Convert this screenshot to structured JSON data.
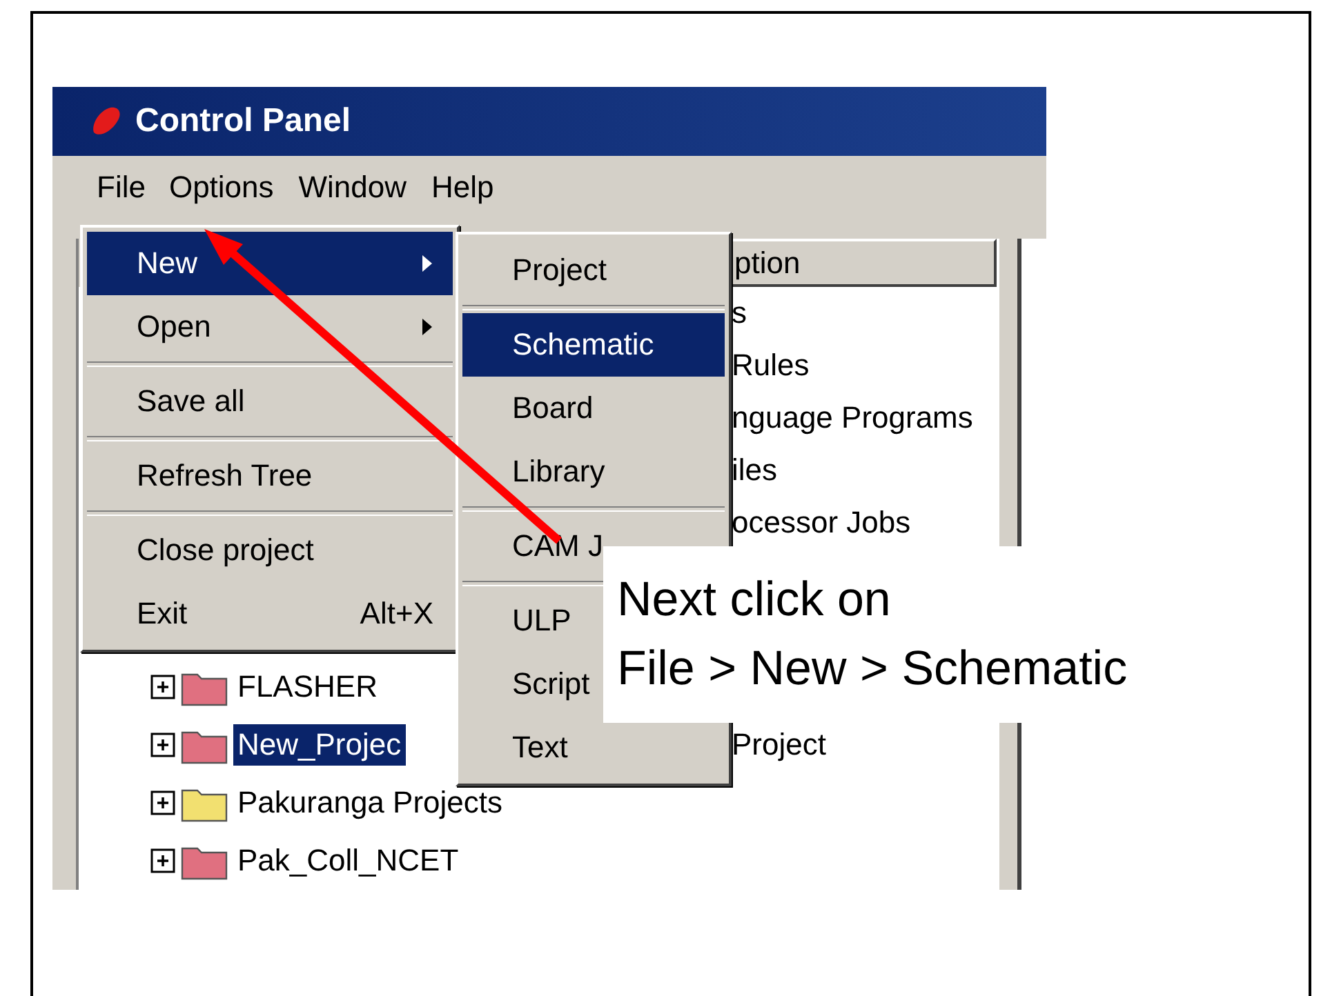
{
  "window": {
    "title": "Control Panel"
  },
  "menu_bar": [
    {
      "label": "File",
      "selected": true
    },
    {
      "label": "Options",
      "selected": false
    },
    {
      "label": "Window",
      "selected": false
    },
    {
      "label": "Help",
      "selected": false
    }
  ],
  "description_header": "ption",
  "description_cells": [
    "s",
    "Rules",
    "nguage Programs",
    "iles",
    "ocessor Jobs"
  ],
  "tree": [
    {
      "name": "FLASHER",
      "color": "#e07080",
      "selected": false
    },
    {
      "name": "New_Projec",
      "color": "#e07080",
      "selected": true,
      "description": "Project"
    },
    {
      "name": "Pakuranga Projects",
      "color": "#f2e070",
      "selected": false
    },
    {
      "name": "Pak_Coll_NCET",
      "color": "#e07080",
      "selected": false
    }
  ],
  "file_menu": [
    {
      "kind": "item",
      "label": "New",
      "selected": true,
      "submenu": true
    },
    {
      "kind": "item",
      "label": "Open",
      "selected": false,
      "submenu": true
    },
    {
      "kind": "separator"
    },
    {
      "kind": "item",
      "label": "Save all",
      "selected": false,
      "submenu": false
    },
    {
      "kind": "separator"
    },
    {
      "kind": "item",
      "label": "Refresh Tree",
      "selected": false,
      "submenu": false
    },
    {
      "kind": "separator"
    },
    {
      "kind": "item",
      "label": "Close project",
      "selected": false,
      "submenu": false
    },
    {
      "kind": "item",
      "label": "Exit",
      "shortcut": "Alt+X",
      "selected": false,
      "submenu": false
    }
  ],
  "new_submenu": [
    {
      "kind": "item",
      "label": "Project",
      "selected": false
    },
    {
      "kind": "separator"
    },
    {
      "kind": "item",
      "label": "Schematic",
      "selected": true
    },
    {
      "kind": "item",
      "label": "Board",
      "selected": false
    },
    {
      "kind": "item",
      "label": "Library",
      "selected": false
    },
    {
      "kind": "separator"
    },
    {
      "kind": "item",
      "label": "CAM J",
      "selected": false
    },
    {
      "kind": "separator"
    },
    {
      "kind": "item",
      "label": "ULP",
      "selected": false
    },
    {
      "kind": "item",
      "label": "Script",
      "selected": false
    },
    {
      "kind": "item",
      "label": "Text",
      "selected": false
    }
  ],
  "callout": [
    "Next click on",
    "File > New > Schematic"
  ]
}
